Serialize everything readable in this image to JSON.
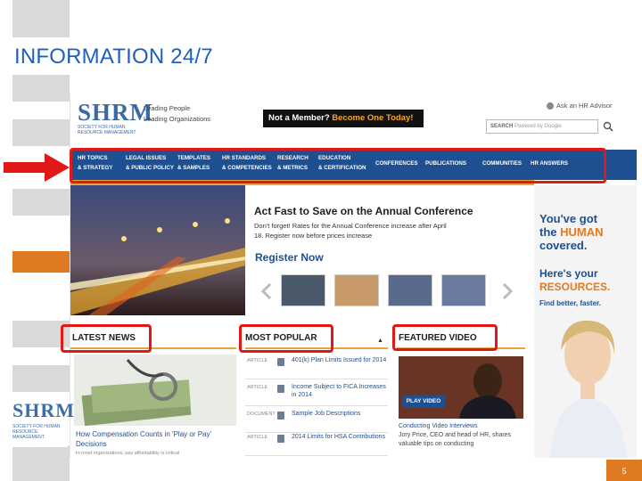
{
  "slide": {
    "title": "INFORMATION 24/7",
    "page_number": "5",
    "logo_text": "SHRM",
    "logo_subtext": "SOCIETY FOR HUMAN RESOURCE MANAGEMENT"
  },
  "site": {
    "logo_text": "SHRM",
    "logo_subtext": "SOCIETY FOR HUMAN RESOURCE MANAGEMENT",
    "tagline_line1": "Leading People",
    "tagline_line2": "Leading Organizations",
    "member_prefix": "Not a Member?",
    "member_cta": "Become One Today!",
    "ask_link": "Ask an HR Advisor",
    "search_label": "SEARCH",
    "search_placeholder": "Powered by Google"
  },
  "nav": {
    "items": [
      {
        "line1": "HR TOPICS",
        "line2": "& STRATEGY"
      },
      {
        "line1": "LEGAL ISSUES",
        "line2": "& PUBLIC POLICY"
      },
      {
        "line1": "TEMPLATES",
        "line2": "& SAMPLES"
      },
      {
        "line1": "HR STANDARDS",
        "line2": "& COMPETENCIES"
      },
      {
        "line1": "RESEARCH",
        "line2": "& METRICS"
      },
      {
        "line1": "EDUCATION",
        "line2": "& CERTIFICATION"
      },
      {
        "line1": "CONFERENCES",
        "line2": ""
      },
      {
        "line1": "PUBLICATIONS",
        "line2": ""
      },
      {
        "line1": "COMMUNITIES",
        "line2": ""
      },
      {
        "line1": "HR ANSWERS",
        "line2": ""
      }
    ]
  },
  "hero": {
    "title": "Act Fast to Save on the Annual Conference",
    "body": "Don't forget! Rates for the Annual Conference increase after April 18. Register now before prices increase",
    "cta": "Register Now"
  },
  "ad": {
    "line1": "You've got",
    "line2_pre": "the ",
    "line2_hl": "HUMAN",
    "line3": "covered.",
    "line4": "Here's your",
    "line5_hl": "RESOURCES.",
    "tag": "Find better, faster."
  },
  "latest": {
    "heading": "LATEST NEWS",
    "caption": "How Compensation Counts in 'Play or Pay' Decisions",
    "more": "In most organizations, pay affordability is critical"
  },
  "popular": {
    "heading": "MOST POPULAR",
    "rows": [
      {
        "type": "ARTICLE",
        "link": "401(k) Plan Limits Issued for 2014"
      },
      {
        "type": "ARTICLE",
        "link": "Income Subject to FICA Increases in 2014"
      },
      {
        "type": "DOCUMENT",
        "link": "Sample Job Descriptions"
      },
      {
        "type": "ARTICLE",
        "link": "2014 Limits for HSA Contributions"
      }
    ]
  },
  "video": {
    "heading": "FEATURED VIDEO",
    "play": "PLAY VIDEO",
    "title": "Conducting Video Interviews",
    "desc": "Jory Price, CEO and head of HR, shares valuable tips on conducting"
  },
  "colors": {
    "slide_title": "#1f5fbf",
    "nav_bg": "#1d4f91",
    "accent_orange": "#e07a22",
    "highlight_red": "#e01818"
  }
}
